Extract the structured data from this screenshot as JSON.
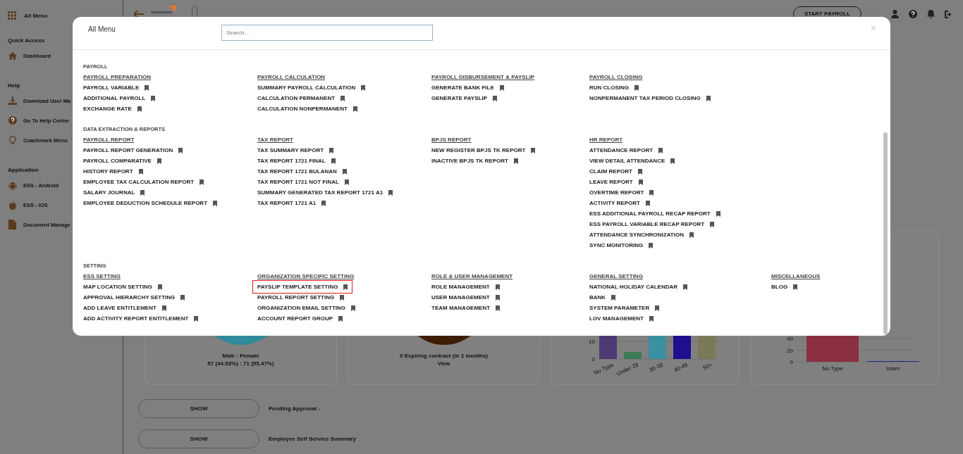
{
  "sidebar": {
    "title": "All Menu",
    "sections": [
      {
        "title": "Quick Access",
        "items": [
          "Dashboard"
        ]
      },
      {
        "title": "Help",
        "items": [
          "Download User Ma",
          "Go To Help Center",
          "Coachmark Menu"
        ]
      },
      {
        "title": "Application",
        "items": [
          "ESS - Android",
          "ESS - IOS",
          "Document Manage"
        ]
      }
    ]
  },
  "top_bar": {
    "start_button": "START PAYROLL"
  },
  "cards": [
    {
      "kind": "pie",
      "color": "#2f8a99",
      "caption": "Male : Female",
      "detail": "57 (44.53%) : 71 (55.47%)"
    },
    {
      "kind": "pie",
      "color": "#3d1e05",
      "caption": "0 Expiring contract (in 2 months)",
      "link": "View"
    },
    {
      "kind": "bars",
      "ticks": [
        "10",
        "0"
      ],
      "bars": [
        {
          "label": "No Type",
          "color": "#4b3b74"
        },
        {
          "label": "Under 29",
          "color": "#3c7a58"
        },
        {
          "label": "30-39",
          "color": "#3a8fa0"
        },
        {
          "label": "40-49",
          "color": "#1d0f8f"
        },
        {
          "label": "50+",
          "color": "#7a7a58"
        }
      ]
    },
    {
      "kind": "bars",
      "ticks": [
        "40",
        "20",
        "0"
      ],
      "bars": [
        {
          "label": "No Type",
          "color": "#8a2f42"
        },
        {
          "label": "Islam",
          "color": "#1a2a80"
        }
      ]
    }
  ],
  "summaries": [
    {
      "button": "SHOW",
      "label": "Pending Approval -"
    },
    {
      "button": "SHOW",
      "label": "Employee Self Service Summary"
    }
  ],
  "modal": {
    "title": "All Menu",
    "search": {
      "placeholder": "Search..."
    },
    "close": "×",
    "sections": [
      {
        "title": "PAYROLL",
        "groups": [
          {
            "title": "PAYROLL PREPARATION",
            "items": [
              {
                "label": "PAYROLL VARIABLE",
                "highlighted": false
              },
              {
                "label": "ADDITIONAL PAYROLL",
                "highlighted": false
              },
              {
                "label": "EXCHANGE RATE",
                "highlighted": false
              }
            ]
          },
          {
            "title": "PAYROLL CALCULATION",
            "items": [
              {
                "label": "SUMMARY PAYROLL CALCULATION",
                "highlighted": false
              },
              {
                "label": "CALCULATION PERMANENT",
                "highlighted": false
              },
              {
                "label": "CALCULATION NONPERMANENT",
                "highlighted": false
              }
            ]
          },
          {
            "title": "PAYROLL DISBURSEMENT & PAYSLIP",
            "items": [
              {
                "label": "GENERATE BANK FILE",
                "highlighted": false
              },
              {
                "label": "GENERATE PAYSLIP",
                "highlighted": false
              }
            ]
          },
          {
            "title": "PAYROLL CLOSING",
            "items": [
              {
                "label": "RUN CLOSING",
                "highlighted": false
              },
              {
                "label": "NONPERMANENT TAX PERIOD CLOSING",
                "highlighted": false
              }
            ]
          }
        ]
      },
      {
        "title": "DATA EXTRACTION & REPORTS",
        "groups": [
          {
            "title": "PAYROLL REPORT",
            "items": [
              {
                "label": "PAYROLL REPORT GENERATION",
                "highlighted": false
              },
              {
                "label": "PAYROLL COMPARATIVE",
                "highlighted": false
              },
              {
                "label": "HISTORY REPORT",
                "highlighted": false
              },
              {
                "label": "EMPLOYEE TAX CALCULATION REPORT",
                "highlighted": false
              },
              {
                "label": "SALARY JOURNAL",
                "highlighted": false
              },
              {
                "label": "EMPLOYEE DEDUCTION SCHEDULE REPORT",
                "highlighted": false
              }
            ]
          },
          {
            "title": "TAX REPORT",
            "items": [
              {
                "label": "TAX SUMMARY REPORT",
                "highlighted": false
              },
              {
                "label": "TAX REPORT 1721 FINAL",
                "highlighted": false
              },
              {
                "label": "TAX REPORT 1721 BULANAN",
                "highlighted": false
              },
              {
                "label": "TAX REPORT 1721 NOT FINAL",
                "highlighted": false
              },
              {
                "label": "SUMMARY GENERATED TAX REPORT 1721 A1",
                "highlighted": false
              },
              {
                "label": "TAX REPORT 1721 A1",
                "highlighted": false
              }
            ]
          },
          {
            "title": "BPJS REPORT",
            "items": [
              {
                "label": "NEW REGISTER BPJS TK REPORT",
                "highlighted": false
              },
              {
                "label": "INACTIVE BPJS TK REPORT",
                "highlighted": false
              }
            ]
          },
          {
            "title": "HR REPORT",
            "items": [
              {
                "label": "ATTENDANCE REPORT",
                "highlighted": false
              },
              {
                "label": "VIEW DETAIL ATTENDANCE",
                "highlighted": false
              },
              {
                "label": "CLAIM REPORT",
                "highlighted": false
              },
              {
                "label": "LEAVE REPORT",
                "highlighted": false
              },
              {
                "label": "OVERTIME REPORT",
                "highlighted": false
              },
              {
                "label": "ACTIVITY REPORT",
                "highlighted": false
              },
              {
                "label": "ESS ADDITIONAL PAYROLL RECAP REPORT",
                "highlighted": false
              },
              {
                "label": "ESS PAYROLL VARIABLE RECAP REPORT",
                "highlighted": false
              },
              {
                "label": "ATTENDANCE SYNCHRONIZATION",
                "highlighted": false
              },
              {
                "label": "SYNC MONITORING",
                "highlighted": false
              }
            ]
          }
        ]
      },
      {
        "title": "SETTING",
        "groups": [
          {
            "title": "ESS SETTING",
            "items": [
              {
                "label": "MAP LOCATION SETTING",
                "highlighted": false
              },
              {
                "label": "APPROVAL HIERARCHY SETTING",
                "highlighted": false
              },
              {
                "label": "ADD LEAVE ENTITLEMENT",
                "highlighted": false
              },
              {
                "label": "ADD ACTIVITY REPORT ENTITLEMENT",
                "highlighted": false
              }
            ]
          },
          {
            "title": "ORGANIZATION SPECIFIC SETTING",
            "items": [
              {
                "label": "PAYSLIP TEMPLATE SETTING",
                "highlighted": true
              },
              {
                "label": "PAYROLL REPORT SETTING",
                "highlighted": false
              },
              {
                "label": "ORGANIZATION EMAIL SETTING",
                "highlighted": false
              },
              {
                "label": "ACCOUNT REPORT GROUP",
                "highlighted": false
              }
            ]
          },
          {
            "title": "ROLE & USER MANAGEMENT",
            "items": [
              {
                "label": "ROLE MANAGEMENT",
                "highlighted": false
              },
              {
                "label": "USER MANAGEMENT",
                "highlighted": false
              },
              {
                "label": "TEAM MANAGEMENT",
                "highlighted": false
              }
            ]
          },
          {
            "title": "GENERAL SETTING",
            "items": [
              {
                "label": "NATIONAL HOLIDAY CALENDAR",
                "highlighted": false
              },
              {
                "label": "BANK",
                "highlighted": false
              },
              {
                "label": "SYSTEM PARAMETER",
                "highlighted": false
              },
              {
                "label": "LOV MANAGEMENT",
                "highlighted": false
              }
            ]
          },
          {
            "title": "MISCELLANEOUS",
            "items": [
              {
                "label": "BLOG",
                "highlighted": false
              }
            ]
          }
        ]
      }
    ]
  }
}
